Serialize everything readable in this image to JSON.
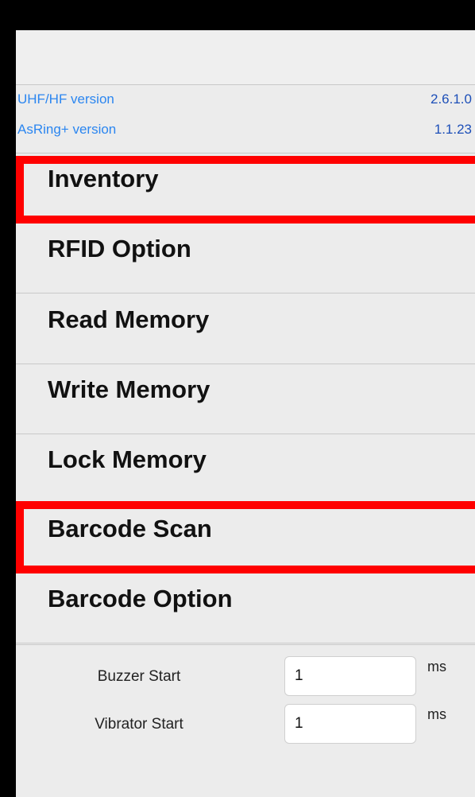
{
  "versions": [
    {
      "label": "UHF/HF version",
      "value": "2.6.1.0"
    },
    {
      "label": "AsRing+ version",
      "value": "1.1.23"
    }
  ],
  "menu": [
    {
      "label": "Inventory",
      "highlighted": true
    },
    {
      "label": "RFID Option",
      "highlighted": false
    },
    {
      "label": "Read Memory",
      "highlighted": false
    },
    {
      "label": "Write Memory",
      "highlighted": false
    },
    {
      "label": "Lock Memory",
      "highlighted": false
    },
    {
      "label": "Barcode Scan",
      "highlighted": true
    },
    {
      "label": "Barcode Option",
      "highlighted": false
    }
  ],
  "options": {
    "buzzer": {
      "label": "Buzzer Start",
      "value": "1",
      "unit": "ms"
    },
    "vibrator": {
      "label": "Vibrator Start",
      "value": "1",
      "unit": "ms"
    }
  },
  "colors": {
    "highlight": "#ff0000",
    "link_label": "#2b86f0",
    "version_value": "#1d4fb8",
    "background": "#ececec"
  }
}
